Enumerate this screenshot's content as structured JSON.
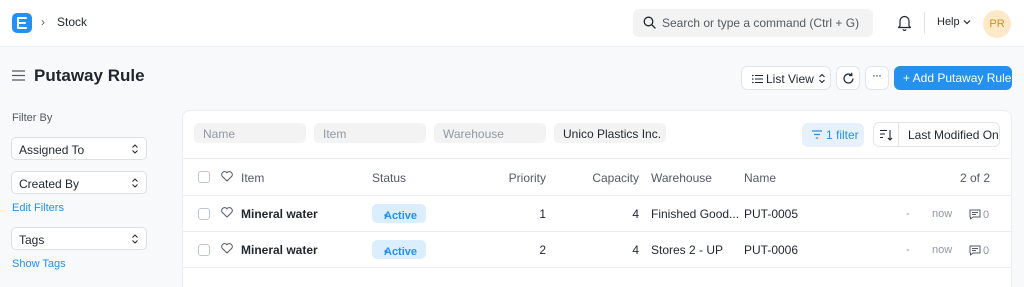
{
  "navbar": {
    "breadcrumb": "Stock",
    "search_placeholder": "Search or type a command (Ctrl + G)",
    "help_label": "Help",
    "avatar_initials": "PR"
  },
  "page": {
    "title": "Putaway Rule",
    "list_view_label": "List View",
    "more_label": "···",
    "primary_action": "+ Add Putaway Rule"
  },
  "sidebar": {
    "filter_by": "Filter By",
    "assigned_to": "Assigned To",
    "created_by": "Created By",
    "edit_filters": "Edit Filters",
    "tags": "Tags",
    "show_tags": "Show Tags"
  },
  "filters": {
    "name_placeholder": "Name",
    "item_placeholder": "Item",
    "warehouse_placeholder": "Warehouse",
    "company_value": "Unico Plastics Inc.",
    "filter_count": "1 filter",
    "sort_by": "Last Modified On"
  },
  "table": {
    "headers": {
      "item": "Item",
      "status": "Status",
      "priority": "Priority",
      "capacity": "Capacity",
      "warehouse": "Warehouse",
      "name": "Name",
      "count": "2 of 2"
    },
    "rows": [
      {
        "item": "Mineral water",
        "status": "Active",
        "priority": "1",
        "capacity": "4",
        "warehouse": "Finished Good...",
        "name": "PUT-0005",
        "dash": "-",
        "modified": "now",
        "comments": "0"
      },
      {
        "item": "Mineral water",
        "status": "Active",
        "priority": "2",
        "capacity": "4",
        "warehouse": "Stores 2 - UP",
        "name": "PUT-0006",
        "dash": "-",
        "modified": "now",
        "comments": "0"
      }
    ]
  },
  "colors": {
    "primary": "#2490ef",
    "badge_bg": "#dbeefd",
    "avatar_bg": "#fde9c7"
  }
}
